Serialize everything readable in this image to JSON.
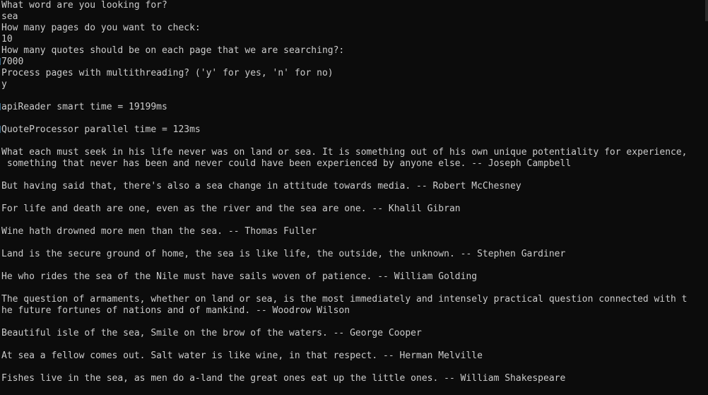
{
  "console": {
    "lines": [
      "What word are you looking for?",
      "sea",
      "How many pages do you want to check:",
      "10",
      "How many quotes should be on each page that we are searching?:",
      "7000",
      "Process pages with multithreading? ('y' for yes, 'n' for no)",
      "y",
      "",
      "apiReader smart time = 19199ms",
      "",
      "QuoteProcessor parallel time = 123ms",
      "",
      "What each must seek in his life never was on land or sea. It is something out of his own unique potentiality for experience,",
      " something that never has been and never could have been experienced by anyone else. -- Joseph Campbell",
      "",
      "But having said that, there's also a sea change in attitude towards media. -- Robert McChesney",
      "",
      "For life and death are one, even as the river and the sea are one. -- Khalil Gibran",
      "",
      "Wine hath drowned more men than the sea. -- Thomas Fuller",
      "",
      "Land is the secure ground of home, the sea is like life, the outside, the unknown. -- Stephen Gardiner",
      "",
      "He who rides the sea of the Nile must have sails woven of patience. -- William Golding",
      "",
      "The question of armaments, whether on land or sea, is the most immediately and intensely practical question connected with t",
      "he future fortunes of nations and of mankind. -- Woodrow Wilson",
      "",
      "Beautiful isle of the sea, Smile on the brow of the waters. -- George Cooper",
      "",
      "At sea a fellow comes out. Salt water is like wine, in that respect. -- Herman Melville",
      "",
      "Fishes live in the sea, as men do a-land the great ones eat up the little ones. -- William Shakespeare"
    ]
  },
  "colors": {
    "background": "#0c0c0c",
    "text": "#cccccc"
  }
}
